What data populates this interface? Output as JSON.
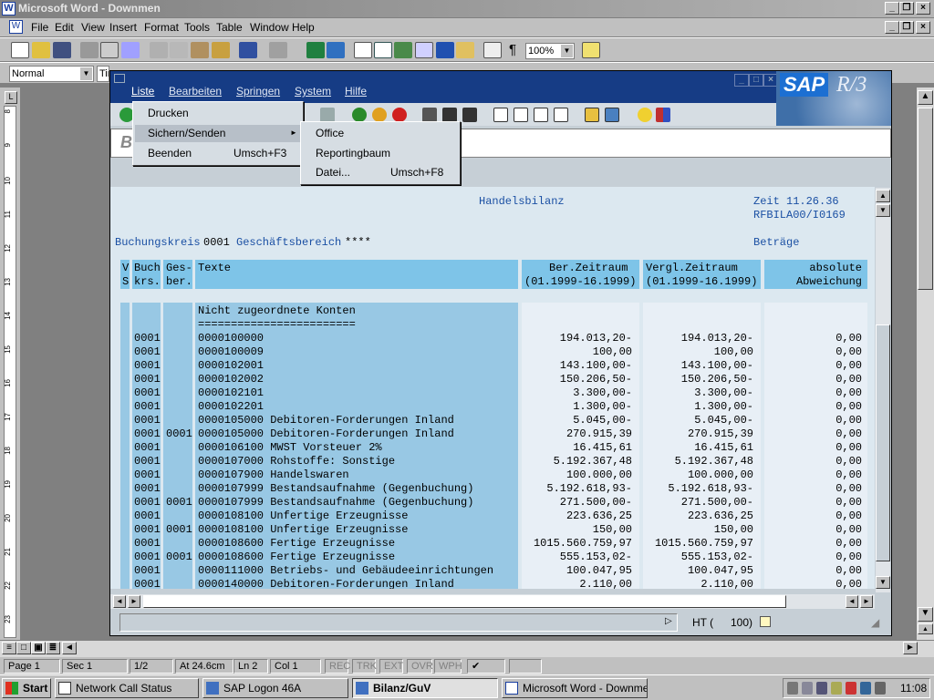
{
  "word": {
    "title": "Microsoft Word - Downmen",
    "menu": [
      "File",
      "Edit",
      "View",
      "Insert",
      "Format",
      "Tools",
      "Table",
      "Window",
      "Help"
    ],
    "zoom": "100%",
    "style": "Normal",
    "font": "Tim",
    "status": {
      "page": "Page 1",
      "sec": "Sec 1",
      "pages": "1/2",
      "at": "At 24.6cm",
      "ln": "Ln 2",
      "col": "Col 1",
      "rec": "REC",
      "trk": "TRK",
      "ext": "EXT",
      "ovr": "OVR",
      "wph": "WPH"
    },
    "ruler": [
      "8",
      "9",
      "10",
      "11",
      "12",
      "13",
      "14",
      "15",
      "16",
      "17",
      "18",
      "19",
      "20",
      "21",
      "22",
      "23"
    ]
  },
  "sap": {
    "menu": [
      "Liste",
      "Bearbeiten",
      "Springen",
      "System",
      "Hilfe"
    ],
    "logo": "SAP",
    "logo_r3": "R/3",
    "title_char": "B",
    "liste_menu": [
      {
        "label": "Drucken",
        "shortcut": ""
      },
      {
        "label": "Sichern/Senden",
        "shortcut": ""
      },
      {
        "label": "Beenden",
        "shortcut": "Umsch+F3"
      }
    ],
    "sub_menu": [
      {
        "label": "Office",
        "shortcut": ""
      },
      {
        "label": "Reportingbaum",
        "shortcut": ""
      },
      {
        "label": "Datei...",
        "shortcut": "Umsch+F8"
      }
    ],
    "status_mode": "HT (",
    "status_value": "100)"
  },
  "report": {
    "title": "Handelsbilanz",
    "time": "Zeit 11.26.36",
    "program": "RFBILA00/I0169",
    "buchungskreis_label": "Buchungskreis",
    "buchungskreis": "0001",
    "geschaeftsbereich_label": "Geschäftsbereich",
    "geschaeftsbereich": "****",
    "betraege": "Beträge",
    "headers": {
      "vs1": "V",
      "vs2": "S",
      "buch1": "Buch",
      "buch2": "krs.",
      "ges1": "Ges-",
      "ges2": "ber.",
      "texte": "Texte",
      "ber1": "Ber.Zeitraum",
      "ber2": "(01.1999-16.1999)",
      "vergl1": "Vergl.Zeitraum",
      "vergl2": "(01.1999-16.1999)",
      "abs1": "absolute",
      "abs2": "Abweichung"
    },
    "section": "Nicht zugeordnete Konten",
    "separator": "========================",
    "rows": [
      [
        "0001",
        "",
        "0000100000",
        "194.013,20-",
        "194.013,20-",
        "0,00"
      ],
      [
        "0001",
        "",
        "0000100009",
        "100,00",
        "100,00",
        "0,00"
      ],
      [
        "0001",
        "",
        "0000102001",
        "143.100,00-",
        "143.100,00-",
        "0,00"
      ],
      [
        "0001",
        "",
        "0000102002",
        "150.206,50-",
        "150.206,50-",
        "0,00"
      ],
      [
        "0001",
        "",
        "0000102101",
        "3.300,00-",
        "3.300,00-",
        "0,00"
      ],
      [
        "0001",
        "",
        "0000102201",
        "1.300,00-",
        "1.300,00-",
        "0,00"
      ],
      [
        "0001",
        "",
        "0000105000 Debitoren-Forderungen Inland",
        "5.045,00-",
        "5.045,00-",
        "0,00"
      ],
      [
        "0001",
        "0001",
        "0000105000 Debitoren-Forderungen Inland",
        "270.915,39",
        "270.915,39",
        "0,00"
      ],
      [
        "0001",
        "",
        "0000106100 MWST Vorsteuer 2%",
        "16.415,61",
        "16.415,61",
        "0,00"
      ],
      [
        "0001",
        "",
        "0000107000 Rohstoffe: Sonstige",
        "5.192.367,48",
        "5.192.367,48",
        "0,00"
      ],
      [
        "0001",
        "",
        "0000107900 Handelswaren",
        "100.000,00",
        "100.000,00",
        "0,00"
      ],
      [
        "0001",
        "",
        "0000107999 Bestandsaufnahme (Gegenbuchung)",
        "5.192.618,93-",
        "5.192.618,93-",
        "0,00"
      ],
      [
        "0001",
        "0001",
        "0000107999 Bestandsaufnahme (Gegenbuchung)",
        "271.500,00-",
        "271.500,00-",
        "0,00"
      ],
      [
        "0001",
        "",
        "0000108100 Unfertige Erzeugnisse",
        "223.636,25",
        "223.636,25",
        "0,00"
      ],
      [
        "0001",
        "0001",
        "0000108100 Unfertige Erzeugnisse",
        "150,00",
        "150,00",
        "0,00"
      ],
      [
        "0001",
        "",
        "0000108600 Fertige Erzeugnisse",
        "1015.560.759,97",
        "1015.560.759,97",
        "0,00"
      ],
      [
        "0001",
        "0001",
        "0000108600 Fertige Erzeugnisse",
        "555.153,02-",
        "555.153,02-",
        "0,00"
      ],
      [
        "0001",
        "",
        "0000111000 Betriebs- und Gebäudeeinrichtungen",
        "100.047,95",
        "100.047,95",
        "0,00"
      ],
      [
        "0001",
        "",
        "0000140000 Debitoren-Forderungen Inland",
        "2.110,00",
        "2.110,00",
        "0,00"
      ]
    ]
  },
  "taskbar": {
    "start": "Start",
    "items": [
      "Network Call Status",
      "SAP Logon 46A",
      "Bilanz/GuV",
      "Microsoft Word - Downmen"
    ],
    "clock": "11:08"
  }
}
